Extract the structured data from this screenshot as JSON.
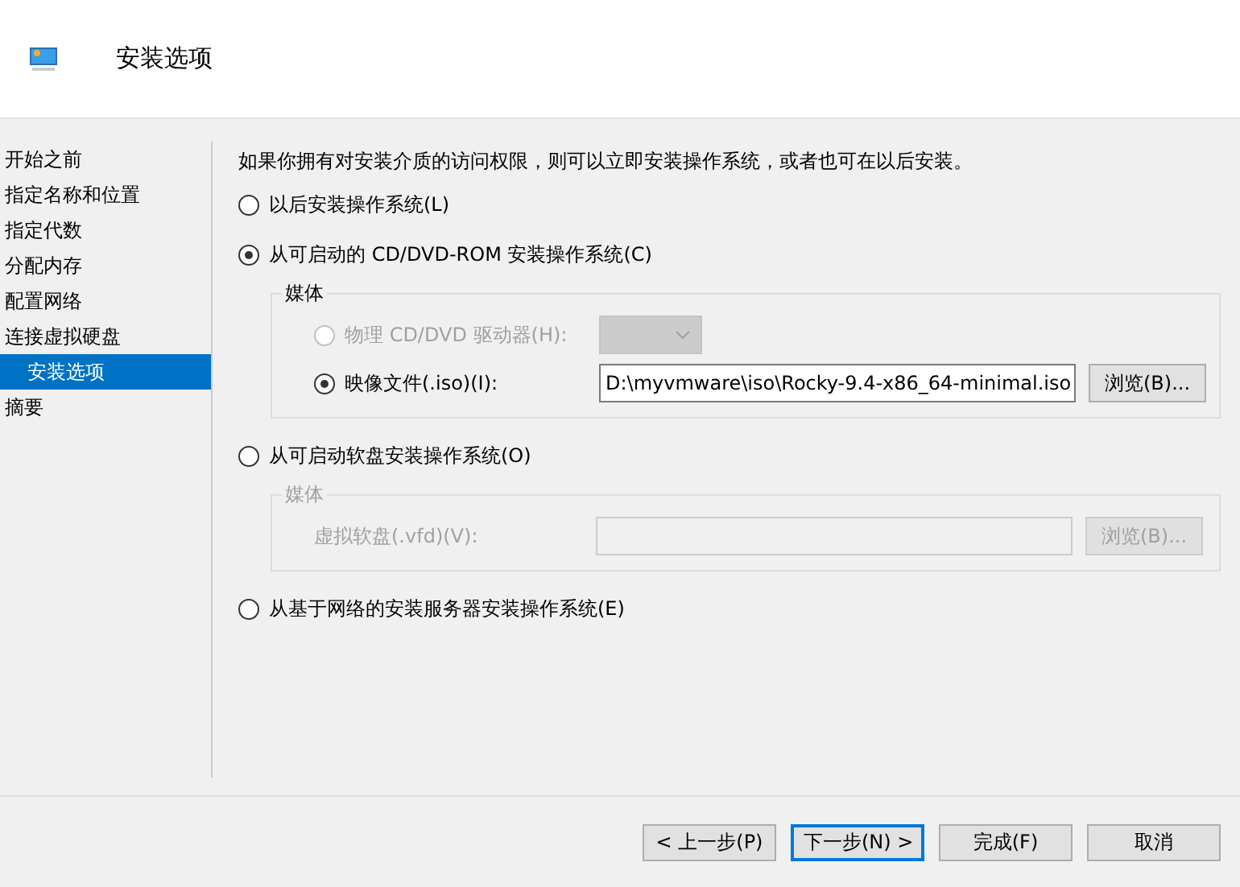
{
  "header": {
    "title": "安装选项"
  },
  "steps": [
    {
      "label": "开始之前",
      "selected": false
    },
    {
      "label": "指定名称和位置",
      "selected": false
    },
    {
      "label": "指定代数",
      "selected": false
    },
    {
      "label": "分配内存",
      "selected": false
    },
    {
      "label": "配置网络",
      "selected": false
    },
    {
      "label": "连接虚拟硬盘",
      "selected": false,
      "children": [
        {
          "label": "安装选项",
          "selected": true
        }
      ]
    },
    {
      "label": "摘要",
      "selected": false
    }
  ],
  "intro": "如果你拥有对安装介质的访问权限，则可以立即安装操作系统，或者也可在以后安装。",
  "options": [
    {
      "label": "以后安装操作系统(L)",
      "selected": false
    },
    {
      "label": "从可启动的 CD/DVD-ROM 安装操作系统(C)",
      "selected": true,
      "media": {
        "title": "媒体",
        "disabled": false,
        "rows": [
          {
            "kind": "drive",
            "label": "物理 CD/DVD 驱动器(H):",
            "selected": false,
            "disabled": true
          },
          {
            "kind": "file",
            "label": "映像文件(.iso)(I):",
            "selected": true,
            "disabled": false,
            "value": "D:\\myvmware\\iso\\Rocky-9.4-x86_64-minimal.iso",
            "button": "浏览(B)..."
          }
        ]
      }
    },
    {
      "label": "从可启动软盘安装操作系统(O)",
      "selected": false,
      "media": {
        "title": "媒体",
        "disabled": true,
        "rows": [
          {
            "kind": "field",
            "label": "虚拟软盘(.vfd)(V):",
            "disabled": true,
            "button": "浏览(B)..."
          }
        ]
      }
    },
    {
      "label": "从基于网络的安装服务器安装操作系统(E)",
      "selected": false
    }
  ],
  "buttons": [
    {
      "label": "< 上一步(P)",
      "focused": false
    },
    {
      "label": "下一步(N) >",
      "focused": true
    },
    {
      "label": "完成(F)",
      "focused": false
    },
    {
      "label": "取消",
      "focused": false
    }
  ]
}
